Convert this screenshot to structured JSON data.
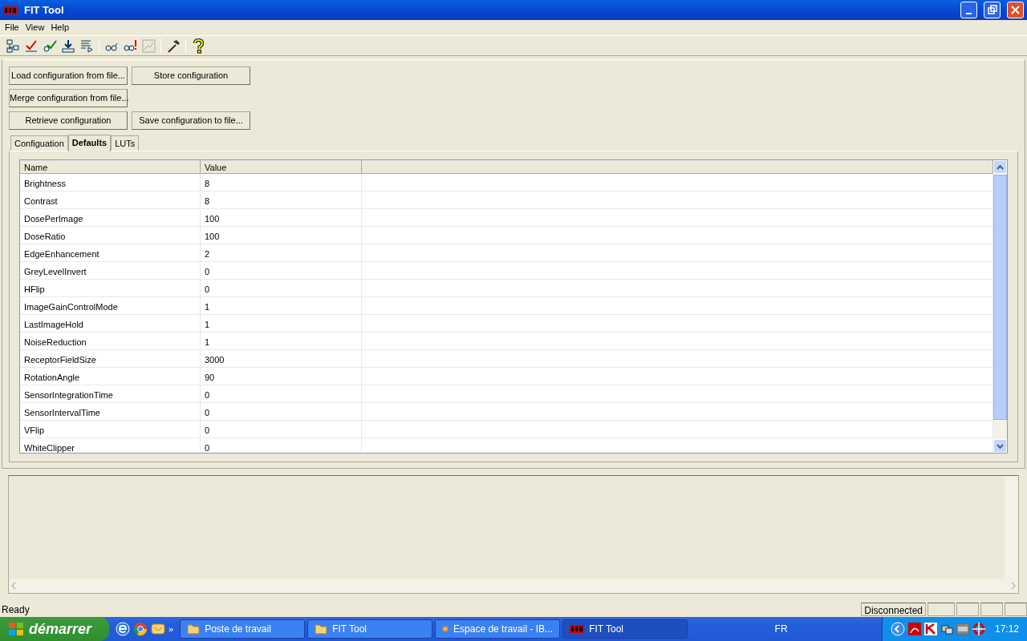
{
  "window": {
    "title": "FIT Tool"
  },
  "menu": [
    "File",
    "View",
    "Help"
  ],
  "buttons": [
    {
      "label": "Load configuration from file..."
    },
    {
      "label": "Store configuration"
    },
    {
      "label": "Merge configuration from file..."
    },
    {
      "label": "Retrieve configuration"
    },
    {
      "label": "Save configuration to file..."
    }
  ],
  "tabs": [
    {
      "label": "Configuation",
      "selected": false
    },
    {
      "label": "Defaults",
      "selected": true
    },
    {
      "label": "LUTs",
      "selected": false
    }
  ],
  "table": {
    "columns": [
      "Name",
      "Value"
    ],
    "rows": [
      [
        "Brightness",
        "8"
      ],
      [
        "Contrast",
        "8"
      ],
      [
        "DosePerImage",
        "100"
      ],
      [
        "DoseRatio",
        "100"
      ],
      [
        "EdgeEnhancement",
        "2"
      ],
      [
        "GreyLevelInvert",
        "0"
      ],
      [
        "HFlip",
        "0"
      ],
      [
        "ImageGainControlMode",
        "1"
      ],
      [
        "LastImageHold",
        "1"
      ],
      [
        "NoiseReduction",
        "1"
      ],
      [
        "ReceptorFieldSize",
        "3000"
      ],
      [
        "RotationAngle",
        "90"
      ],
      [
        "SensorIntegrationTime",
        "0"
      ],
      [
        "SensorIntervalTime",
        "0"
      ],
      [
        "VFlip",
        "0"
      ],
      [
        "WhiteClipper",
        "0"
      ]
    ]
  },
  "status_bar": {
    "message": "Ready",
    "connection": "Disconnected"
  },
  "taskbar": {
    "start": "démarrer",
    "quick_launch_more": "»",
    "tasks": [
      {
        "label": "Poste de travail",
        "selected": false
      },
      {
        "label": "FIT Tool",
        "selected": false
      },
      {
        "label": "Espace de travail - IB...",
        "selected": false
      },
      {
        "label": "FIT Tool",
        "selected": true
      }
    ],
    "language": "FR",
    "clock": "17:12"
  }
}
